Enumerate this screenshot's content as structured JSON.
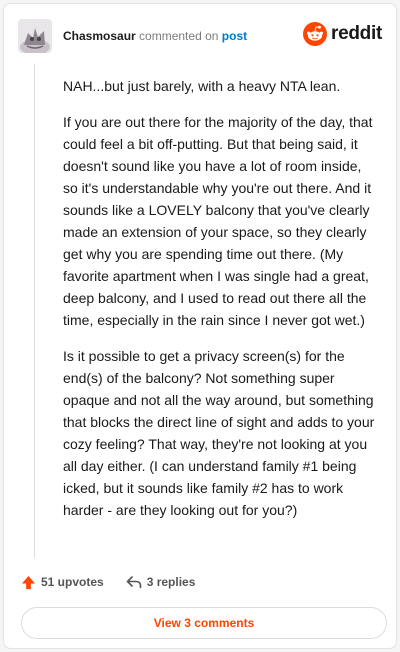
{
  "header": {
    "username": "Chasmosaur",
    "verb": "commented on",
    "post_link": "post",
    "brand": "reddit"
  },
  "comment": {
    "paragraphs": [
      "NAH...but just barely, with a heavy NTA lean.",
      "If you are out there for the majority of the day, that could feel a bit off-putting. But that being said, it doesn't sound like you have a lot of room inside, so it's understandable why you're out there. And it sounds like a LOVELY balcony that you've clearly made an extension of your space, so they clearly get why you are spending time out there. (My favorite apartment when I was single had a great, deep balcony, and I used to read out there all the time, especially in the rain since I never got wet.)",
      "Is it possible to get a privacy screen(s) for the end(s) of the balcony? Not something super opaque and not all the way around, but something that blocks the direct line of sight and adds to your cozy feeling? That way, they're not looking at you all day either. (I can understand family #1 being icked, but it sounds like family #2 has to work harder - are they looking out for you?)"
    ]
  },
  "actions": {
    "upvotes": "51 upvotes",
    "replies": "3 replies"
  },
  "view_comments_label": "View 3 comments",
  "colors": {
    "accent": "#ff4500",
    "link": "#0079d3"
  },
  "icons": {
    "upvote": "upvote-arrow-icon",
    "reply": "reply-arrow-icon",
    "brand": "reddit-snoo-icon"
  }
}
